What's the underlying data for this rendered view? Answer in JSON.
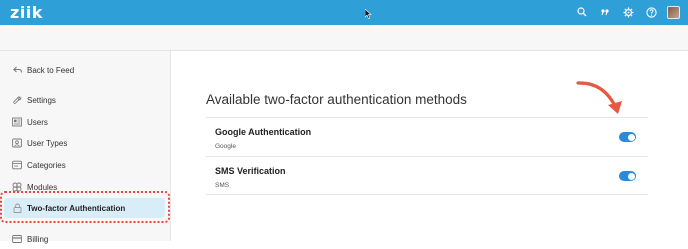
{
  "app": {
    "logo_text": "ziik"
  },
  "topbar": {
    "icons": [
      "search-icon",
      "quote-icon",
      "gear-icon",
      "help-icon",
      "user-avatar"
    ]
  },
  "sidebar": {
    "back_label": "Back to Feed",
    "items": [
      {
        "label": "Settings",
        "icon": "wrench-icon"
      },
      {
        "label": "Users",
        "icon": "users-icon"
      },
      {
        "label": "User Types",
        "icon": "user-types-icon"
      },
      {
        "label": "Categories",
        "icon": "categories-icon"
      },
      {
        "label": "Modules",
        "icon": "modules-icon"
      },
      {
        "label": "Two-factor Authentication",
        "icon": "lock-icon",
        "active": true
      },
      {
        "label": "Billing",
        "icon": "billing-icon"
      }
    ]
  },
  "main": {
    "heading": "Available two-factor authentication methods",
    "methods": [
      {
        "title": "Google Authentication",
        "subtitle": "Google",
        "enabled": true
      },
      {
        "title": "SMS Verification",
        "subtitle": "SMS",
        "enabled": true
      }
    ]
  },
  "colors": {
    "topbar": "#2f9fd8",
    "toggle_on": "#2b8ad8",
    "highlight_border": "#e8473a",
    "active_bg": "#d8edf8",
    "arrow": "#e8573f"
  }
}
